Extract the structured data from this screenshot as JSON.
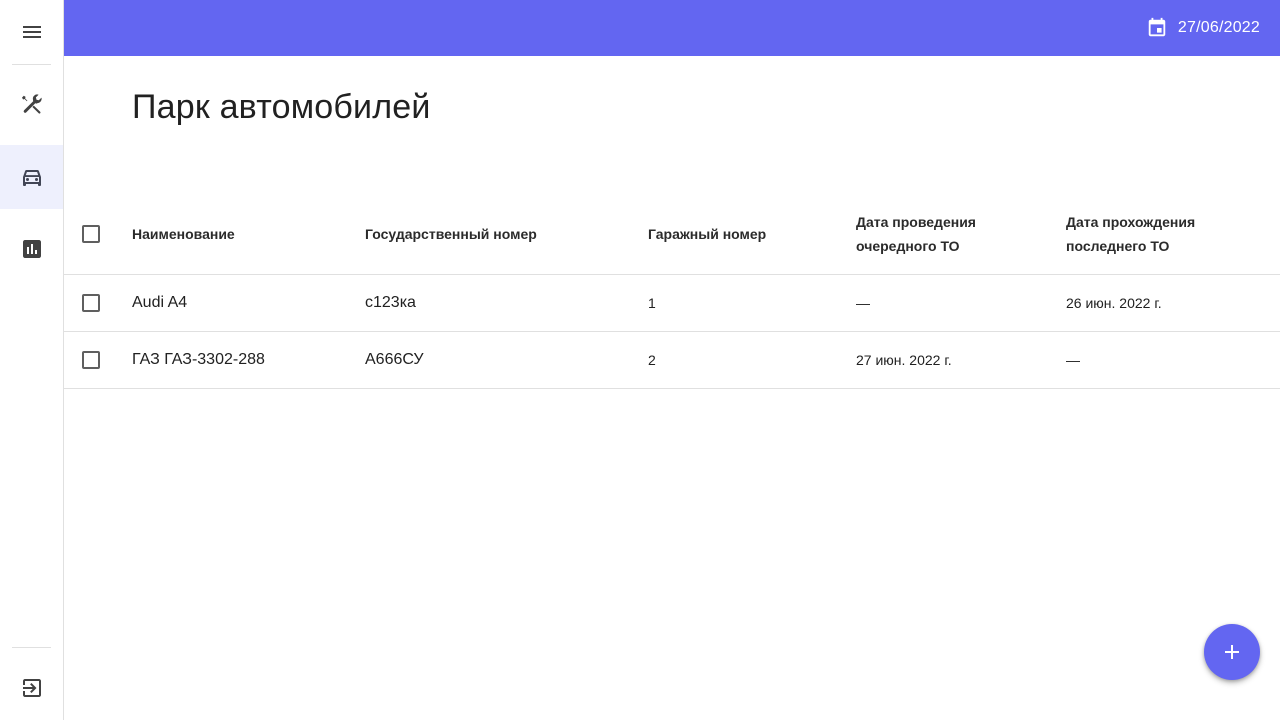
{
  "colors": {
    "accent": "#6366f1",
    "sidebar_active": "#eef0fd"
  },
  "sidebar": {
    "menu_icon": "menu-icon",
    "items": [
      {
        "icon": "tools-icon",
        "active": false
      },
      {
        "icon": "car-icon",
        "active": true
      },
      {
        "icon": "bar-chart-icon",
        "active": false
      }
    ],
    "logout_icon": "logout-icon"
  },
  "header": {
    "date_icon": "calendar-icon",
    "date": "27/06/2022"
  },
  "page": {
    "title": "Парк автомобилей"
  },
  "table": {
    "columns": {
      "name": "Наименование",
      "gov_number": "Государственный номер",
      "garage_number": "Гаражный номер",
      "next_to_line1": "Дата проведения",
      "next_to_line2": "очередного ТО",
      "last_to_line1": "Дата прохождения",
      "last_to_line2": "последнего ТО"
    },
    "rows": [
      {
        "name": "Audi A4",
        "gov_number": "с123ка",
        "garage_number": "1",
        "next_to": "—",
        "last_to": "26 июн. 2022 г."
      },
      {
        "name": "ГАЗ ГАЗ-3302-288",
        "gov_number": "А666СУ",
        "garage_number": "2",
        "next_to": "27 июн. 2022 г.",
        "last_to": "—"
      }
    ]
  },
  "fab": {
    "icon": "plus-icon"
  }
}
